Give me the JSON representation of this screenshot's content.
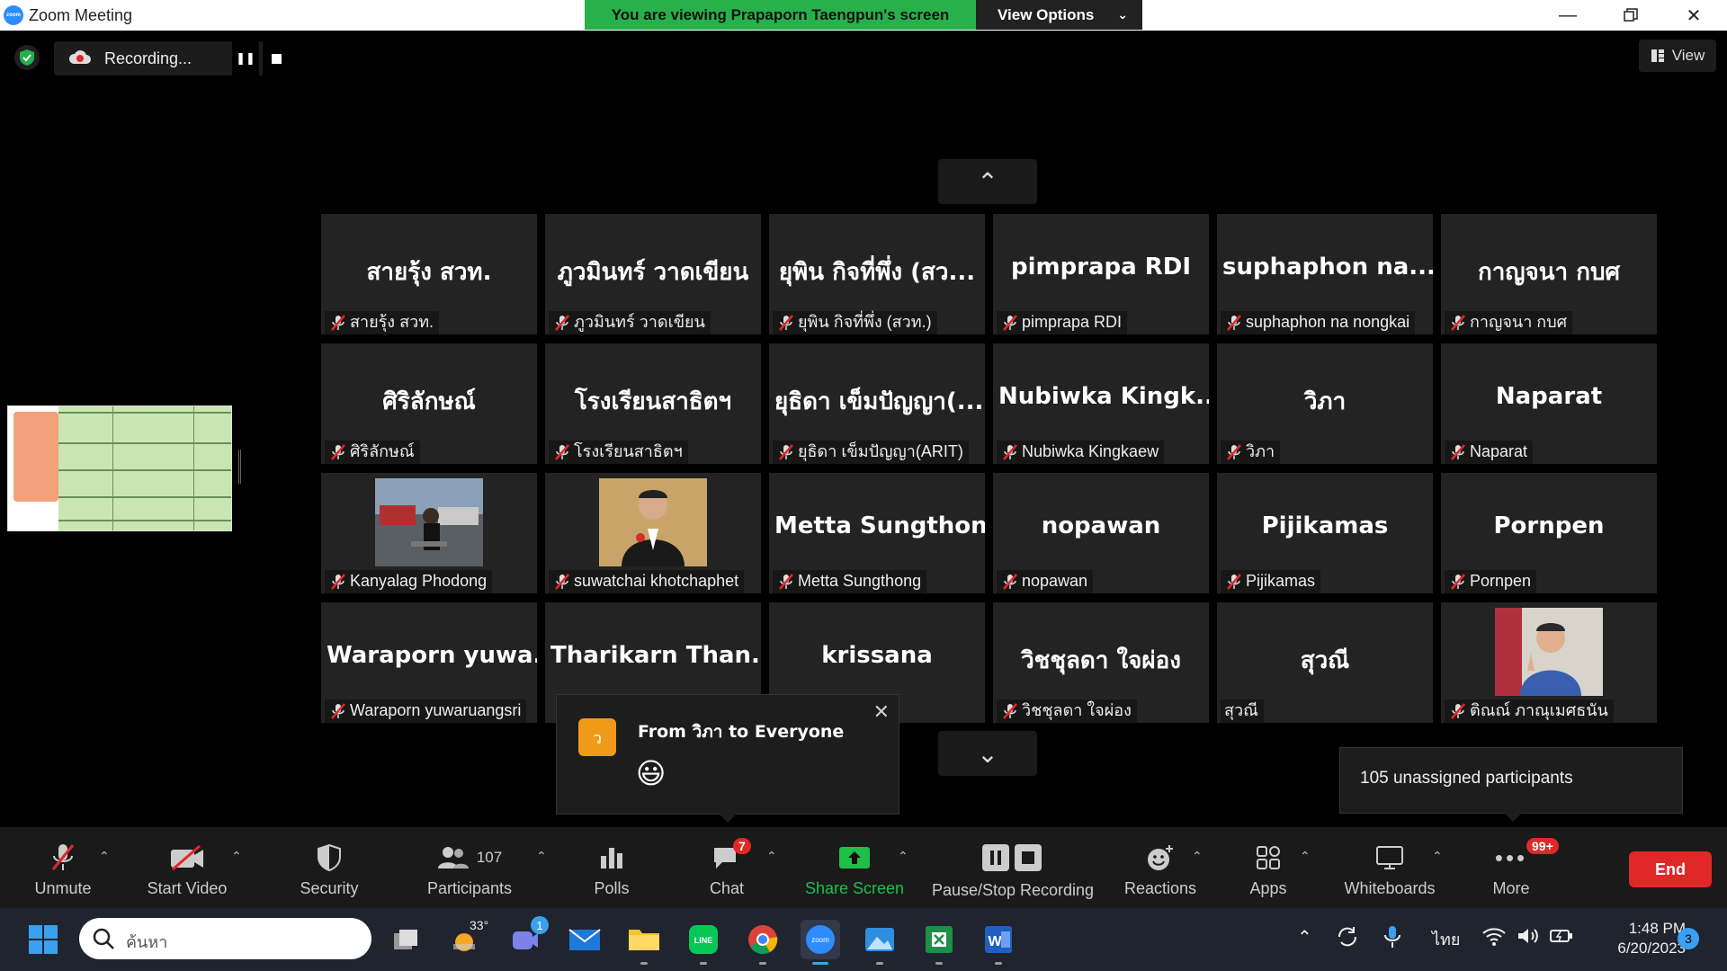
{
  "window": {
    "title": "Zoom Meeting",
    "app_icon": "zoom"
  },
  "banner": {
    "viewing": "You are viewing Prapaporn Taengpun's screen",
    "view_options": "View Options"
  },
  "topbar": {
    "recording": "Recording...",
    "view": "View"
  },
  "tiles": [
    {
      "big": "สายรุ้ง สวท.",
      "name": "สายรุ้ง สวท.",
      "muted": true
    },
    {
      "big": "ภูวมินทร์ วาดเขียน",
      "name": "ภูวมินทร์ วาดเขียน",
      "muted": true
    },
    {
      "big": "ยุพิน กิจที่พึ่ง (สว...",
      "name": "ยุพิน กิจที่พึ่ง (สวท.)",
      "muted": true
    },
    {
      "big": "pimprapa RDI",
      "name": "pimprapa RDI",
      "muted": true
    },
    {
      "big": "suphaphon  na...",
      "name": "suphaphon na nongkai",
      "muted": true
    },
    {
      "big": "กาญจนา กบศ",
      "name": "กาญจนา กบศ",
      "muted": true
    },
    {
      "big": "ศิริลักษณ์",
      "name": "ศิริลักษณ์",
      "muted": true
    },
    {
      "big": "โรงเรียนสาธิตฯ",
      "name": "โรงเรียนสาธิตฯ",
      "muted": true
    },
    {
      "big": "ยุธิดา เข็มปัญญา(...",
      "name": "ยุธิดา เข็มปัญญา(ARIT)",
      "muted": true
    },
    {
      "big": "Nubiwka  Kingk...",
      "name": "Nubiwka Kingkaew",
      "muted": true
    },
    {
      "big": "วิภา",
      "name": "วิภา",
      "muted": true
    },
    {
      "big": "Naparat",
      "name": "Naparat",
      "muted": true
    },
    {
      "big": "",
      "name": "Kanyalag Phodong",
      "muted": true,
      "photo": "woman-seated"
    },
    {
      "big": "",
      "name": "suwatchai khotchaphet",
      "muted": true,
      "photo": "man-suit"
    },
    {
      "big": "Metta Sungthong",
      "name": "Metta Sungthong",
      "muted": true
    },
    {
      "big": "nopawan",
      "name": "nopawan",
      "muted": true
    },
    {
      "big": "Pijikamas",
      "name": "Pijikamas",
      "muted": true
    },
    {
      "big": "Pornpen",
      "name": "Pornpen",
      "muted": true
    },
    {
      "big": "Waraporn  yuwa...",
      "name": "Waraporn yuwaruangsri",
      "muted": true
    },
    {
      "big": "Tharikarn  Than...",
      "name": "",
      "muted": true
    },
    {
      "big": "krissana",
      "name": "",
      "muted": false
    },
    {
      "big": "วิชชุลดา ใจผ่อง",
      "name": "วิชชุลดา ใจผ่อง",
      "muted": true
    },
    {
      "big": "สุวณี",
      "name": "สุวณี",
      "muted": false
    },
    {
      "big": "",
      "name": "ติณณ์ ภาณุเมศธนัน",
      "muted": true,
      "photo": "boy-peace"
    }
  ],
  "chat_popup": {
    "avatar_letter": "ว",
    "from": "From วิภา to Everyone",
    "message": "😃"
  },
  "unassigned": {
    "text": "105 unassigned participants"
  },
  "toolbar": {
    "unmute": "Unmute",
    "start_video": "Start Video",
    "security": "Security",
    "participants": "Participants",
    "participants_count": "107",
    "polls": "Polls",
    "chat": "Chat",
    "chat_badge": "7",
    "share_screen": "Share Screen",
    "pause_stop": "Pause/Stop Recording",
    "reactions": "Reactions",
    "apps": "Apps",
    "whiteboards": "Whiteboards",
    "more": "More",
    "more_badge": "99+",
    "end": "End"
  },
  "taskbar": {
    "search_placeholder": "ค้นหา",
    "weather_temp": "33°",
    "teams_badge": "1",
    "language": "ไทย",
    "time": "1:48 PM",
    "date": "6/20/2023",
    "notifications": "3"
  },
  "colors": {
    "banner_green": "#28b04a",
    "end_red": "#e02828",
    "share_green": "#1fbf4a",
    "zoom_blue": "#2D8CFF"
  }
}
